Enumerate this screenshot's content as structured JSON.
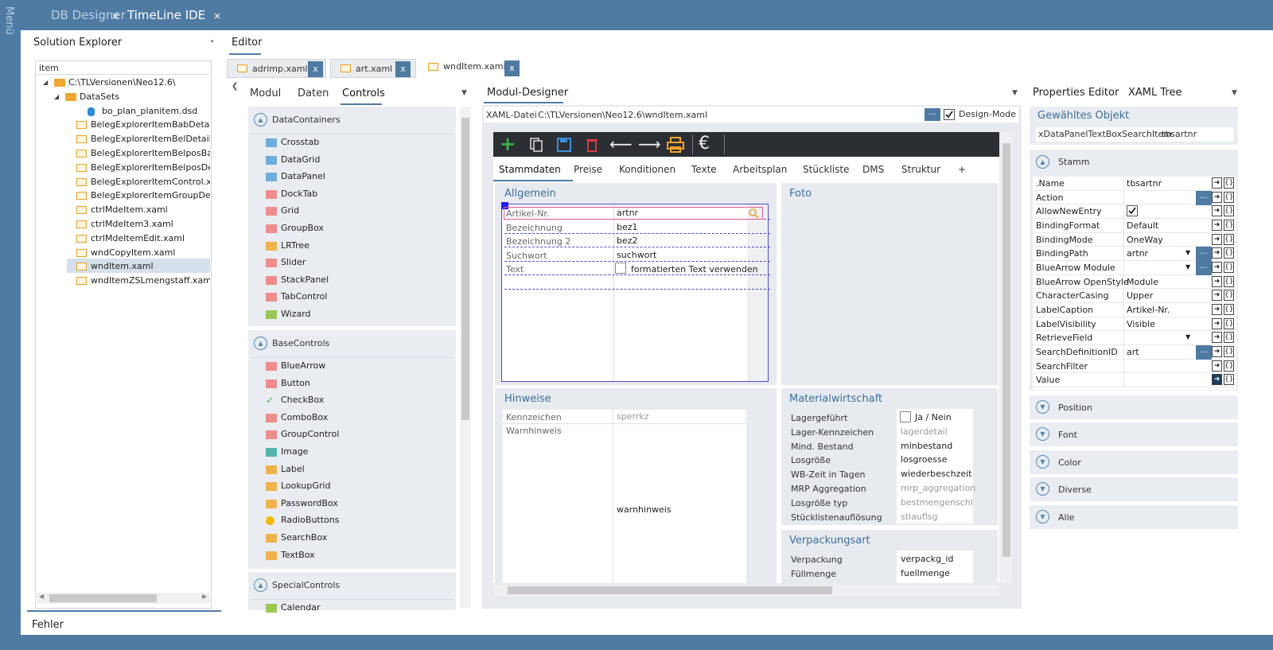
{
  "sidebar": {
    "menu_label": "Menü"
  },
  "app_tabs": [
    {
      "label": "DB Designer",
      "close": "×"
    },
    {
      "label": "TimeLine IDE",
      "close": "×"
    }
  ],
  "solution_explorer": {
    "title": "Solution Explorer",
    "pin": "•",
    "search_value": "item",
    "tree": [
      {
        "label": "C:\\TLVersionen\\Neo12.6\\",
        "icon": "folder-icon"
      },
      {
        "label": "DataSets",
        "icon": "folder-icon"
      },
      {
        "label": "bo_plan_planitem.dsd",
        "icon": "dataset-icon"
      },
      {
        "label": "BelegExplorerItemBabDetailsCo",
        "icon": "xaml-file-icon"
      },
      {
        "label": "BelegExplorerItemBelDetailsCor",
        "icon": "xaml-file-icon"
      },
      {
        "label": "BelegExplorerItemBelposBabDe",
        "icon": "xaml-file-icon"
      },
      {
        "label": "BelegExplorerItemBelposDetails",
        "icon": "xaml-file-icon"
      },
      {
        "label": "BelegExplorerItemControl.xaml",
        "icon": "xaml-file-icon"
      },
      {
        "label": "BelegExplorerItemGroupDetails",
        "icon": "xaml-file-icon"
      },
      {
        "label": "ctrlMdeItem.xaml",
        "icon": "xaml-file-icon"
      },
      {
        "label": "ctrlMdeItem3.xaml",
        "icon": "xaml-file-icon"
      },
      {
        "label": "ctrlMdeItemEdit.xaml",
        "icon": "xaml-file-icon"
      },
      {
        "label": "wndCopyItem.xaml",
        "icon": "xaml-file-icon"
      },
      {
        "label": "wndItem.xaml",
        "icon": "xaml-file-icon"
      },
      {
        "label": "wndItemZSLmengstaff.xaml",
        "icon": "xaml-file-icon"
      }
    ]
  },
  "editor": {
    "title": "Editor",
    "file_tabs": [
      {
        "label": "adrimp.xaml",
        "close": "x"
      },
      {
        "label": "art.xaml",
        "close": "x"
      },
      {
        "label": "wndItem.xaml",
        "close": "x"
      }
    ]
  },
  "toolbox": {
    "tabs": [
      "Modul",
      "Daten",
      "Controls"
    ],
    "groups": [
      {
        "title": "DataContainers",
        "toggle": "▲",
        "items": [
          "Crosstab",
          "DataGrid",
          "DataPanel",
          "DockTab",
          "Grid",
          "GroupBox",
          "LRTree",
          "Slider",
          "StackPanel",
          "TabControl",
          "Wizard"
        ]
      },
      {
        "title": "BaseControls",
        "toggle": "▲",
        "items": [
          "BlueArrow",
          "Button",
          "CheckBox",
          "ComboBox",
          "GroupControl",
          "Image",
          "Label",
          "LookupGrid",
          "PasswordBox",
          "RadioButtons",
          "SearchBox",
          "TextBox"
        ]
      },
      {
        "title": "SpecialControls",
        "toggle": "▲",
        "items": [
          "Calendar"
        ]
      }
    ]
  },
  "designer": {
    "title": "Modul-Designer",
    "xaml_label": "XAML-Datei",
    "xaml_path": "C:\\TLVersionen\\Neo12.6\\wndItem.xaml",
    "browse_label": "...",
    "design_mode_label": "Design-Mode",
    "form_tabs": [
      "Stammdaten",
      "Preise",
      "Konditionen",
      "Texte",
      "Arbeitsplan",
      "Stückliste",
      "DMS",
      "Struktur",
      "+"
    ],
    "allgemein": {
      "title": "Allgemein",
      "fields": [
        {
          "label": "Artikel-Nr.",
          "value": "artnr"
        },
        {
          "label": "Bezeichnung",
          "value": "bez1"
        },
        {
          "label": "Bezeichnung 2",
          "value": "bez2"
        },
        {
          "label": "Suchwort",
          "value": "suchwort"
        },
        {
          "label": "Text",
          "value": "formatierten Text verwenden"
        }
      ]
    },
    "foto": {
      "title": "Foto"
    },
    "hinweise": {
      "title": "Hinweise",
      "fields": [
        {
          "label": "Kennzeichen",
          "value": "sperrkz"
        },
        {
          "label": "Warnhinweis",
          "value": "warnhinweis"
        }
      ]
    },
    "materialwirtschaft": {
      "title": "Materialwirtschaft",
      "fields": [
        {
          "label": "Lagergeführt",
          "value": "Ja / Nein"
        },
        {
          "label": "Lager-Kennzeichen",
          "value": "lagerdetail"
        },
        {
          "label": "Mind. Bestand",
          "value": "minbestand"
        },
        {
          "label": "Losgröße",
          "value": "losgroesse"
        },
        {
          "label": "WB-Zeit in Tagen",
          "value": "wiederbeschzeit"
        },
        {
          "label": "MRP Aggregation",
          "value": "mrp_aggregation"
        },
        {
          "label": "Losgröße typ",
          "value": "bestmengenschl"
        },
        {
          "label": "Stücklistenauflösung",
          "value": "stlauflsg"
        }
      ]
    },
    "verpackungsart": {
      "title": "Verpackungsart",
      "fields": [
        {
          "label": "Verpackung",
          "value": "verpackg_id"
        },
        {
          "label": "Füllmenge",
          "value": "fuellmenge"
        }
      ]
    }
  },
  "properties": {
    "tabs": [
      "Properties Editor",
      "XAML Tree"
    ],
    "selected_title": "Gewähltes Objekt",
    "selected_type": "xDataPanelTextBoxSearchItem",
    "selected_name": "tbsartnr",
    "stamm_title": "Stamm",
    "rows": [
      {
        "name": ".Name",
        "value": "tbsartnr"
      },
      {
        "name": "Action",
        "value": ""
      },
      {
        "name": "AllowNewEntry",
        "value": ""
      },
      {
        "name": "BindingFormat",
        "value": "Default"
      },
      {
        "name": "BindingMode",
        "value": "OneWay"
      },
      {
        "name": "BindingPath",
        "value": "artnr"
      },
      {
        "name": "BlueArrow Module",
        "value": ""
      },
      {
        "name": "BlueArrow OpenStyle",
        "value": "Module"
      },
      {
        "name": "CharacterCasing",
        "value": "Upper"
      },
      {
        "name": "LabelCaption",
        "value": "Artikel-Nr."
      },
      {
        "name": "LabelVisibility",
        "value": "Visible"
      },
      {
        "name": "RetrieveField",
        "value": ""
      },
      {
        "name": "SearchDefinitionID",
        "value": "art"
      },
      {
        "name": "SearchFilter",
        "value": ""
      },
      {
        "name": "Value",
        "value": ""
      }
    ],
    "sections": [
      "Position",
      "Font",
      "Color",
      "Diverse",
      "Alle"
    ]
  },
  "bottom": {
    "errors_label": "Fehler"
  }
}
